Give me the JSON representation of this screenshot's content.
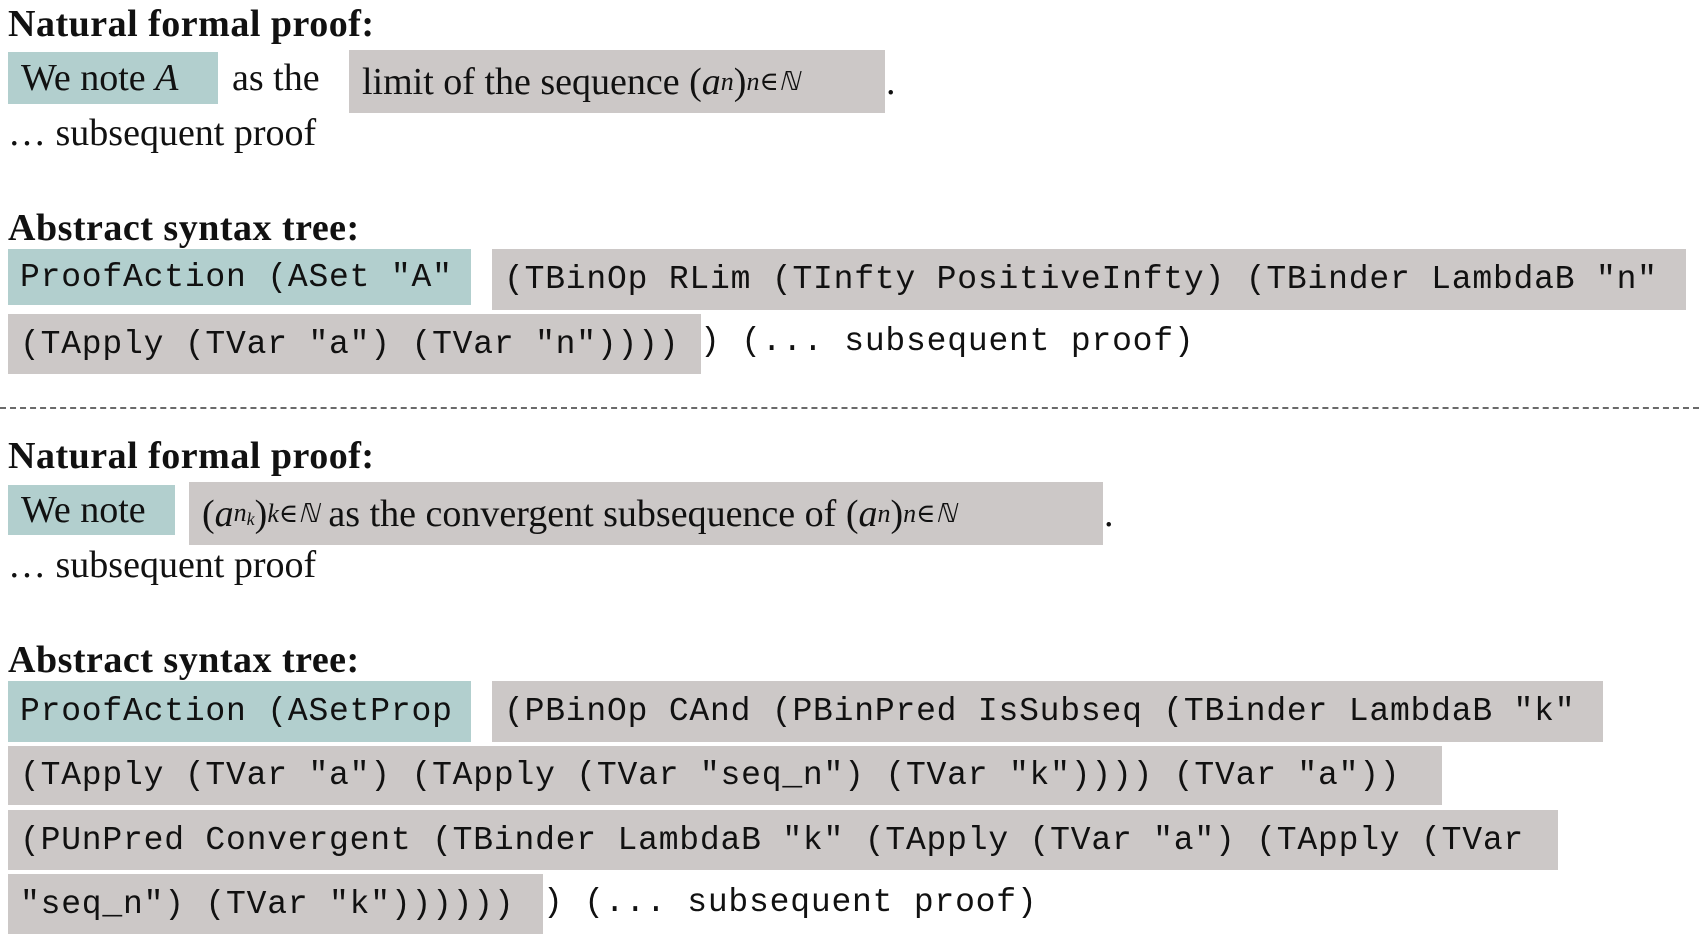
{
  "colors": {
    "action_highlight": "#b2cfce",
    "argument_highlight": "#ccc8c7",
    "divider": "#6a6a6a",
    "text": "#111111"
  },
  "examples": [
    {
      "natural_heading": "Natural formal proof:",
      "natural": {
        "action": "We note A",
        "connector": "as the",
        "argument": "limit of the sequence (a_n)_{n∈ℕ}",
        "argument_parts": {
          "text": "limit of the sequence ",
          "open": "(",
          "var": "a",
          "var_sub": "n",
          "close": ")",
          "index_sub": "n∈ℕ"
        },
        "action_parts": {
          "text": "We note ",
          "var": "A"
        },
        "end": ".",
        "continuation": "… subsequent proof"
      },
      "ast_heading": "Abstract syntax tree:",
      "ast": {
        "action": "ProofAction (ASet \"A\"",
        "argument_lines": [
          "(TBinOp RLim (TInfty PositiveInfty) (TBinder LambdaB \"n\"",
          "(TApply (TVar \"a\") (TVar \"n\"))))"
        ],
        "tail": ") (... subsequent proof)"
      }
    },
    {
      "natural_heading": "Natural formal proof:",
      "natural": {
        "action": "We note",
        "argument": "(a_{n_k})_{k∈ℕ} as the convergent subsequence of (a_n)_{n∈ℕ}",
        "argument_parts": {
          "open": "(",
          "var": "a",
          "var_sub": "n",
          "var_subsub": "k",
          "close": ")",
          "index_sub": "k∈ℕ",
          "text": " as the convergent subsequence of ",
          "open2": "(",
          "var2": "a",
          "var2_sub": "n",
          "close2": ")",
          "index2_sub": "n∈ℕ"
        },
        "end": ".",
        "continuation": "… subsequent proof"
      },
      "ast_heading": "Abstract syntax tree:",
      "ast": {
        "action": "ProofAction (ASetProp",
        "argument_lines": [
          "(PBinOp CAnd (PBinPred IsSubseq (TBinder LambdaB \"k\"",
          "(TApply (TVar \"a\") (TApply (TVar \"seq_n\") (TVar \"k\")))) (TVar \"a\"))",
          "(PUnPred Convergent (TBinder LambdaB \"k\" (TApply (TVar \"a\") (TApply (TVar",
          "\"seq_n\") (TVar \"k\"))))))"
        ],
        "tail": ") (... subsequent proof)"
      }
    }
  ]
}
